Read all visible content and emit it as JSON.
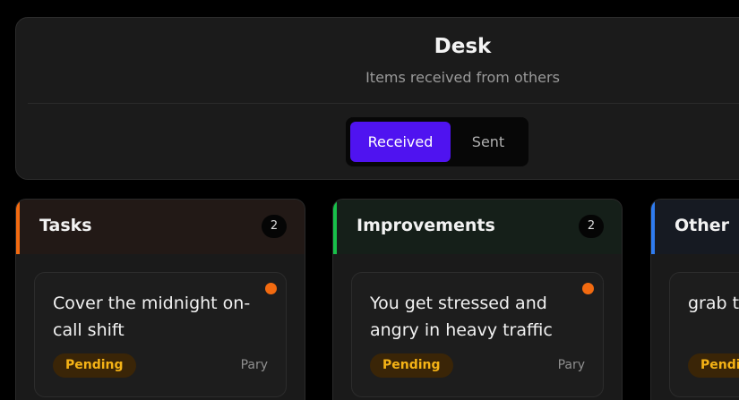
{
  "header": {
    "title": "Desk",
    "subtitle": "Items received from others",
    "toggle": {
      "received_label": "Received",
      "sent_label": "Sent"
    }
  },
  "colors": {
    "accent": "#4f13f0",
    "tasks": "#f26a10",
    "improvements": "#18c04a",
    "other": "#2f7cf0",
    "pending_text": "#f5b316",
    "pending_bg": "#3a2507"
  },
  "columns": [
    {
      "title": "Tasks",
      "count": "2",
      "card": {
        "text": "Cover the midnight on-call shift",
        "status": "Pending",
        "author": "Pary"
      }
    },
    {
      "title": "Improvements",
      "count": "2",
      "card": {
        "text": "You get stressed and angry in heavy traffic",
        "status": "Pending",
        "author": "Pary"
      }
    },
    {
      "title": "Other",
      "count": "",
      "card": {
        "text": "grab the trash out of",
        "status": "Pending",
        "author": ""
      }
    }
  ]
}
